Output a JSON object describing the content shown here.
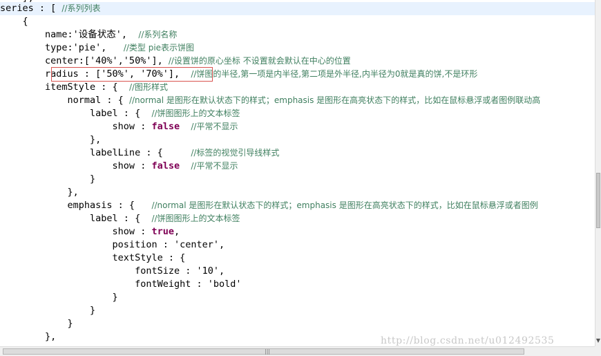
{
  "code": {
    "top_partial": "    },",
    "l1": {
      "code": "series : [ ",
      "comment": "//系列列表"
    },
    "l2": {
      "code": "    {"
    },
    "l3": {
      "code": "        name:'设备状态',  ",
      "comment": "//系列名称"
    },
    "l4": {
      "code": "        type:'pie',   ",
      "comment": "//类型 pie表示饼图"
    },
    "l5": {
      "code": "        center:['40%','50%'], ",
      "comment": "//设置饼的原心坐标 不设置就会默认在中心的位置"
    },
    "l6": {
      "code": "        radius : ['50%', '70%'],  ",
      "comment": "//饼图的半径,第一项是内半径,第二项是外半径,内半径为0就是真的饼,不是环形"
    },
    "l7": {
      "code": "        itemStyle : {  ",
      "comment": "//图形样式"
    },
    "l8": {
      "code": "            normal : { ",
      "comment": "//normal 是图形在默认状态下的样式；emphasis 是图形在高亮状态下的样式，比如在鼠标悬浮或者图例联动高"
    },
    "l9": {
      "code": "                label : {  ",
      "comment": "//饼图图形上的文本标签"
    },
    "l10": {
      "pre": "                    show : ",
      "kw": "false",
      "post": "  ",
      "comment": "//平常不显示"
    },
    "l11": {
      "code": "                },"
    },
    "l12": {
      "code": "                labelLine : {     ",
      "comment": "//标签的视觉引导线样式"
    },
    "l13": {
      "pre": "                    show : ",
      "kw": "false",
      "post": "  ",
      "comment": "//平常不显示"
    },
    "l14": {
      "code": "                }"
    },
    "l15": {
      "code": "            },"
    },
    "l16": {
      "code": "            emphasis : {   ",
      "comment": "//normal 是图形在默认状态下的样式；emphasis 是图形在高亮状态下的样式，比如在鼠标悬浮或者图例"
    },
    "l17": {
      "code": "                label : {  ",
      "comment": "//饼图图形上的文本标签"
    },
    "l18": {
      "pre": "                    show : ",
      "kw": "true",
      "post": ","
    },
    "l19": {
      "code": "                    position : 'center',"
    },
    "l20": {
      "code": "                    textStyle : {"
    },
    "l21": {
      "code": "                        fontSize : '10',"
    },
    "l22": {
      "code": "                        fontWeight : 'bold'"
    },
    "l23": {
      "code": "                    }"
    },
    "l24": {
      "code": "                }"
    },
    "l25": {
      "code": "            }"
    },
    "l26": {
      "code": "        },"
    }
  },
  "watermark": "http://blog.csdn.net/u012492535",
  "colors": {
    "comment": "#3f7f5f",
    "keyword": "#7f0055",
    "highlight_line": "#e8f2fe",
    "annotation_box": "#d9534f"
  }
}
